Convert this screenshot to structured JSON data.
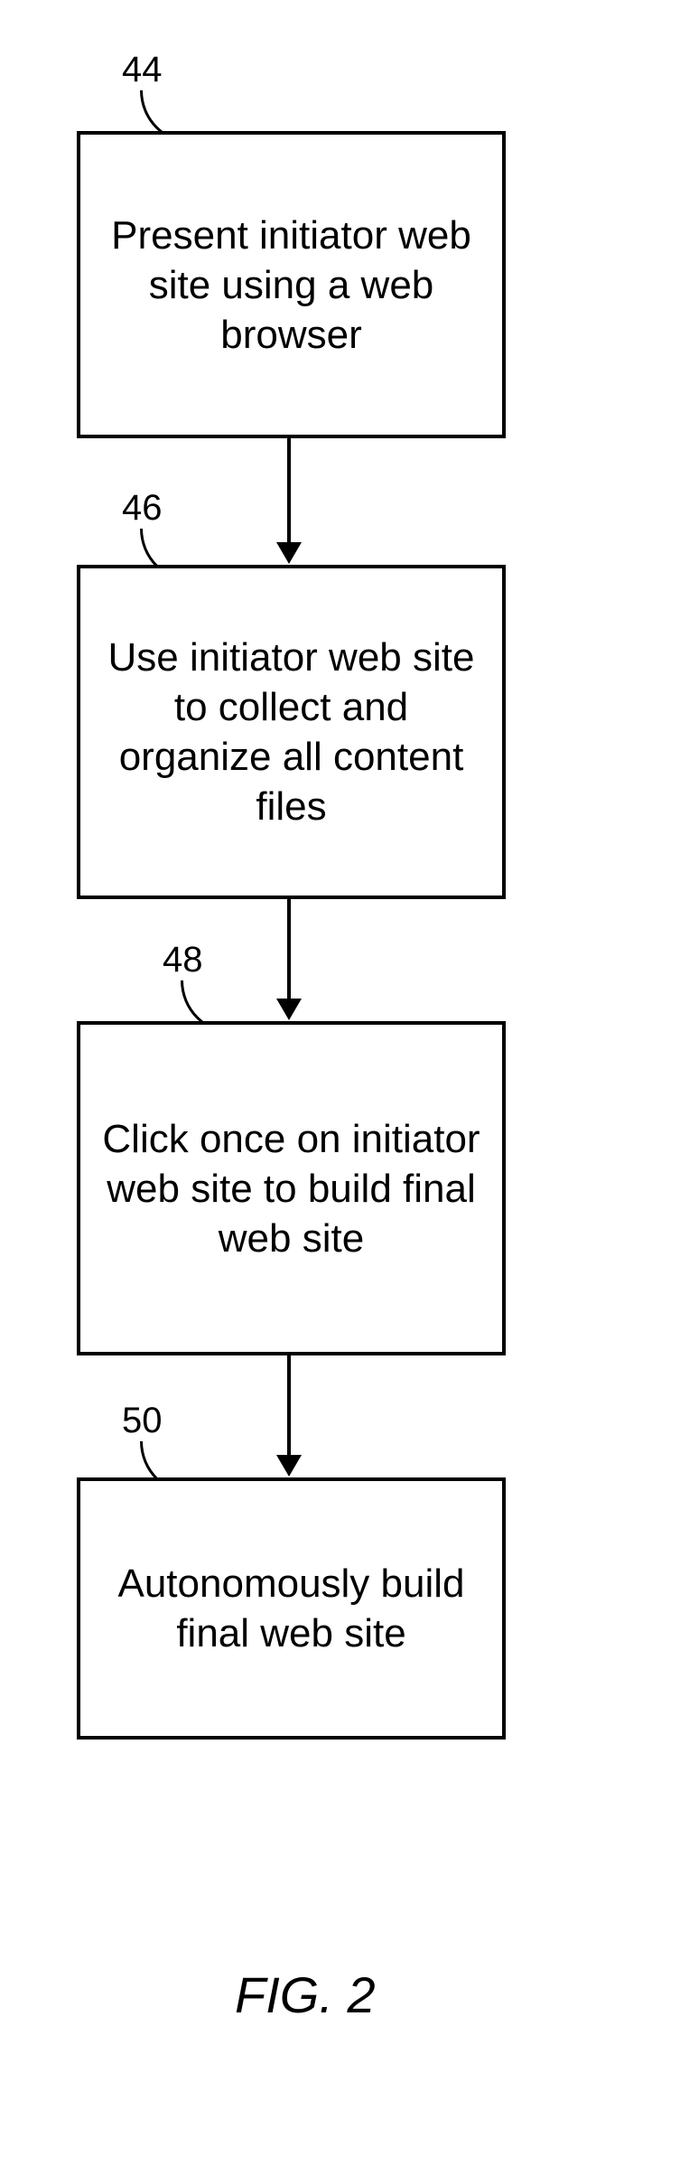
{
  "boxes": {
    "b44": {
      "ref": "44",
      "text": "Present initiator web site using a web browser"
    },
    "b46": {
      "ref": "46",
      "text": "Use initiator web site to collect and organize all content files"
    },
    "b48": {
      "ref": "48",
      "text": "Click once on initiator web site to build final web site"
    },
    "b50": {
      "ref": "50",
      "text": "Autonomously build final web site"
    }
  },
  "caption": "FIG. 2"
}
